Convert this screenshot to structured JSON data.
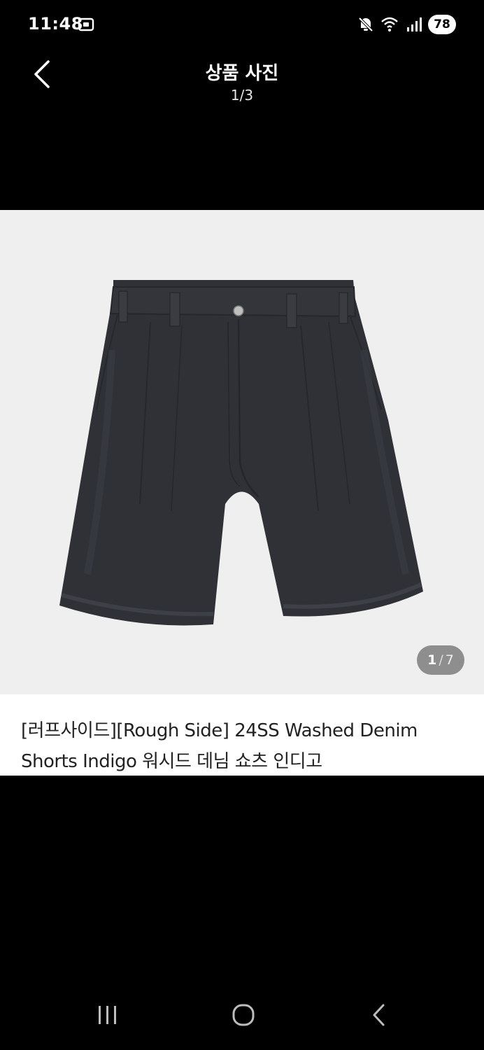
{
  "status_bar": {
    "time": "11:48",
    "battery": "78",
    "icons": [
      "screen-capture-icon",
      "mute-icon",
      "wifi-icon",
      "signal-icon"
    ]
  },
  "header": {
    "title": "상품 사진",
    "counter": "1/3",
    "back_icon": "chevron-left-icon"
  },
  "product": {
    "image_alt": "denim-shorts-image",
    "pager": {
      "current": "1",
      "separator": "/",
      "total": "7"
    },
    "title": "[러프사이드][Rough Side] 24SS Washed Denim Shorts Indigo 워시드 데님 쇼츠 인디고"
  },
  "nav_bar": {
    "icons": [
      "recents-icon",
      "home-icon",
      "back-icon"
    ]
  },
  "colors": {
    "background": "#000000",
    "image_bg": "#efefef",
    "denim": "#2f3136",
    "title_text": "#222222"
  }
}
